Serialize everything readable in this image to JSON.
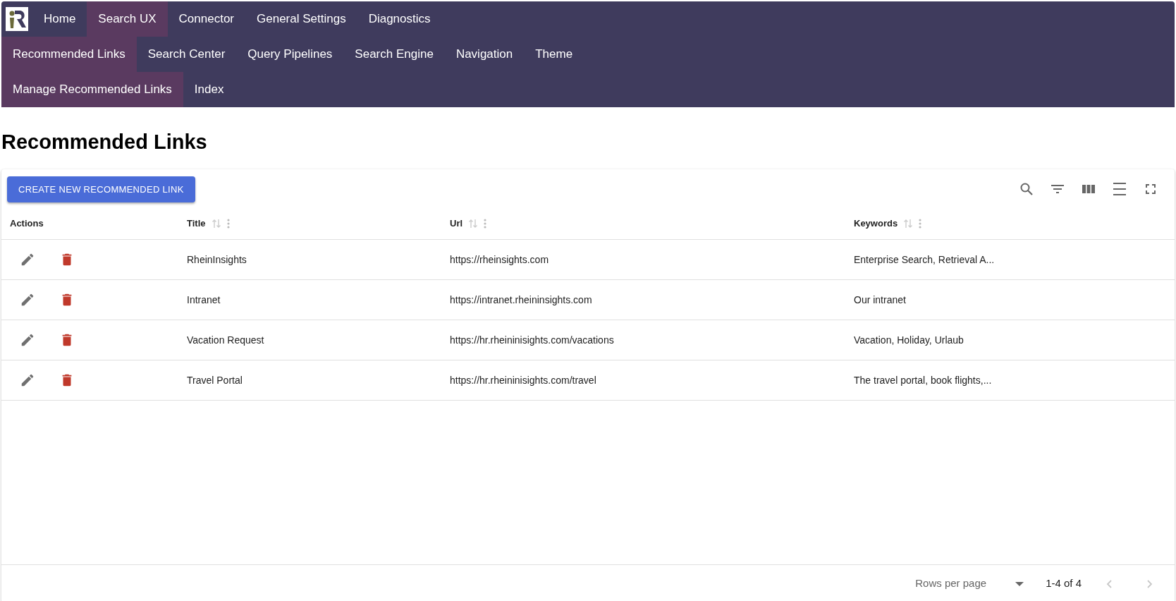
{
  "nav_rows": [
    {
      "items": [
        {
          "label": "Home",
          "selected": false
        },
        {
          "label": "Search UX",
          "selected": true
        },
        {
          "label": "Connector",
          "selected": false
        },
        {
          "label": "General Settings",
          "selected": false
        },
        {
          "label": "Diagnostics",
          "selected": false
        }
      ]
    },
    {
      "items": [
        {
          "label": "Recommended Links",
          "selected": true
        },
        {
          "label": "Search Center",
          "selected": false
        },
        {
          "label": "Query Pipelines",
          "selected": false
        },
        {
          "label": "Search Engine",
          "selected": false
        },
        {
          "label": "Navigation",
          "selected": false
        },
        {
          "label": "Theme",
          "selected": false
        }
      ]
    },
    {
      "items": [
        {
          "label": "Manage Recommended Links",
          "selected": true
        },
        {
          "label": "Index",
          "selected": false
        }
      ]
    }
  ],
  "page_title": "Recommended Links",
  "create_button": "CREATE NEW RECOMMENDED LINK",
  "table": {
    "columns": [
      {
        "label": "Actions",
        "sortable": false
      },
      {
        "label": "Title",
        "sortable": true
      },
      {
        "label": "Url",
        "sortable": true
      },
      {
        "label": "Keywords",
        "sortable": true
      }
    ],
    "rows": [
      {
        "title": "RheinInsights",
        "url": "https://rheinsights.com",
        "keywords": "Enterprise Search, Retrieval A..."
      },
      {
        "title": "Intranet",
        "url": "https://intranet.rheininsights.com",
        "keywords": "Our intranet"
      },
      {
        "title": "Vacation Request",
        "url": "https://hr.rheininisights.com/vacations",
        "keywords": "Vacation, Holiday, Urlaub"
      },
      {
        "title": "Travel Portal",
        "url": "https://hr.rheininisights.com/travel",
        "keywords": "The travel portal, book flights,..."
      }
    ]
  },
  "pagination": {
    "rows_per_page_label": "Rows per page",
    "range": "1-4 of 4",
    "prev_disabled": true,
    "next_disabled": true
  }
}
